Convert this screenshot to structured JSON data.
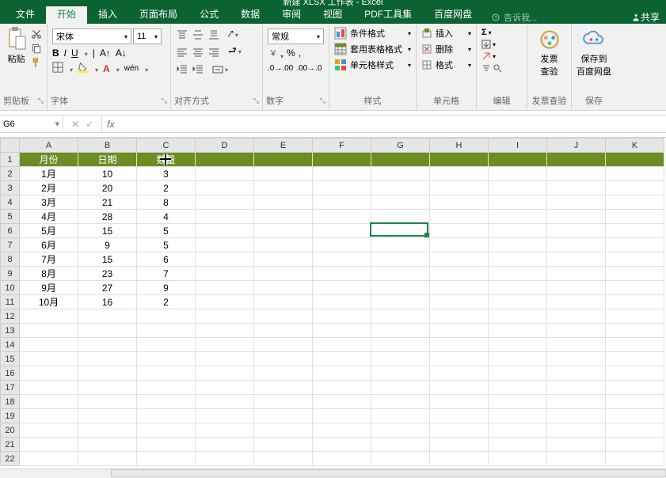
{
  "title": "新建 XLSX 工作表 - Excel",
  "tabs": [
    "文件",
    "开始",
    "插入",
    "页面布局",
    "公式",
    "数据",
    "审阅",
    "视图",
    "PDF工具集",
    "百度网盘"
  ],
  "active_tab": 1,
  "tell_me": "告诉我...",
  "share": "共享",
  "ribbon": {
    "clipboard": {
      "paste": "粘贴",
      "label": "剪贴板"
    },
    "font": {
      "name": "宋体",
      "size": "11",
      "wen": "wén",
      "label": "字体"
    },
    "align": {
      "label": "对齐方式"
    },
    "number": {
      "format": "常规",
      "label": "数字"
    },
    "styles": {
      "cond": "条件格式",
      "table": "套用表格格式",
      "cell": "单元格样式",
      "label": "样式"
    },
    "cells": {
      "insert": "插入",
      "delete": "删除",
      "format": "格式",
      "label": "单元格"
    },
    "edit": {
      "label": "编辑"
    },
    "invoice": {
      "btn": "发票\n查验",
      "label": "发票查验"
    },
    "save": {
      "btn": "保存到\n百度网盘",
      "label": "保存"
    }
  },
  "name_box": "G6",
  "columns": [
    "A",
    "B",
    "C",
    "D",
    "E",
    "F",
    "G",
    "H",
    "I",
    "J",
    "K"
  ],
  "header_row": [
    "月份",
    "日期",
    "数量"
  ],
  "data_rows": [
    [
      "1月",
      "10",
      "3"
    ],
    [
      "2月",
      "20",
      "2"
    ],
    [
      "3月",
      "21",
      "8"
    ],
    [
      "4月",
      "28",
      "4"
    ],
    [
      "5月",
      "15",
      "5"
    ],
    [
      "6月",
      "9",
      "5"
    ],
    [
      "7月",
      "15",
      "6"
    ],
    [
      "8月",
      "23",
      "7"
    ],
    [
      "9月",
      "27",
      "9"
    ],
    [
      "10月",
      "16",
      "2"
    ]
  ],
  "empty_rows_after": 11,
  "active_cell": {
    "col": "G",
    "row": 6
  },
  "cursor_at": {
    "col": "C",
    "row": 1
  }
}
